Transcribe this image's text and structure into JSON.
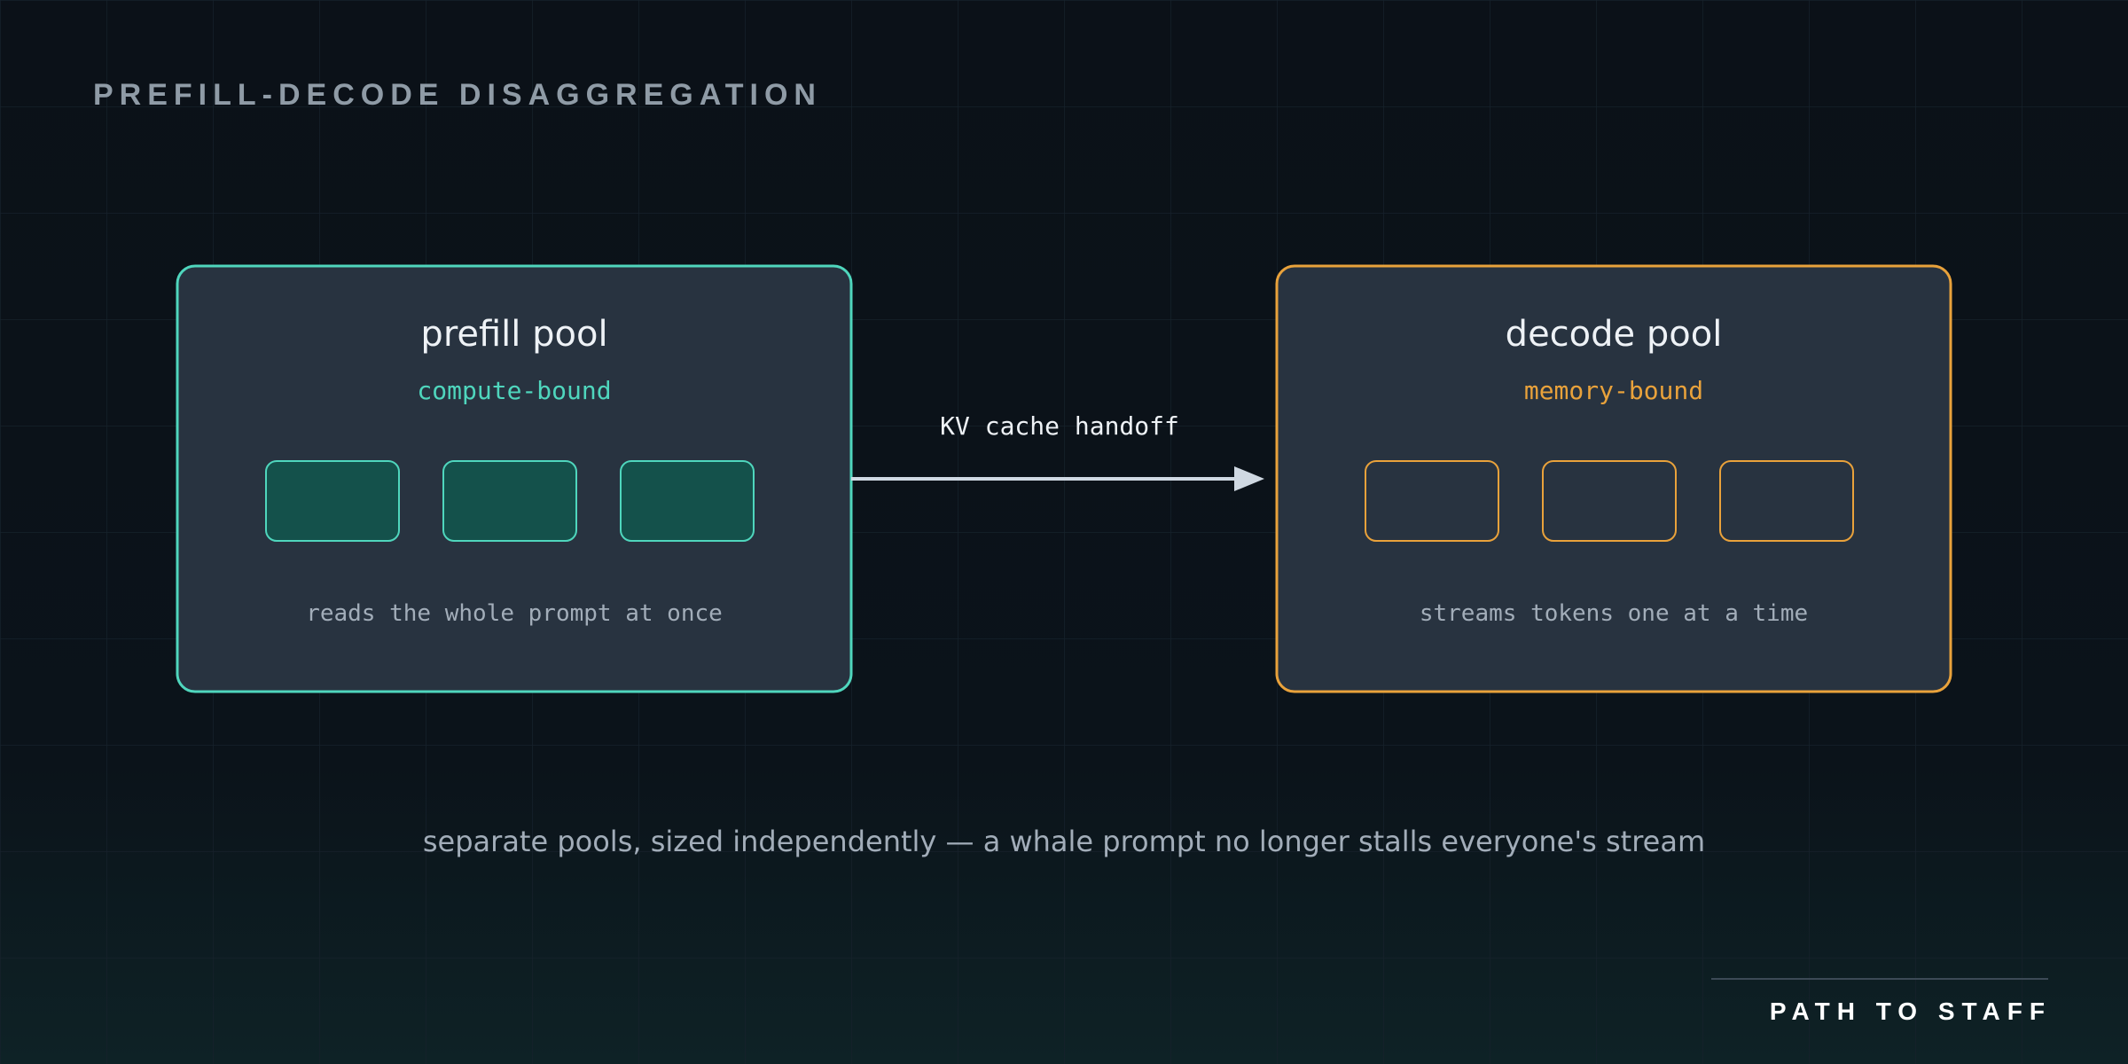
{
  "header": {
    "title": "PREFILL-DECODE DISAGGREGATION"
  },
  "pools": [
    {
      "name": "prefill pool",
      "subtitle": "compute-bound",
      "caption": "reads the whole prompt at once",
      "accent": "#4fd6bd",
      "unit_fill": "#14514b",
      "unit_count": 3
    },
    {
      "name": "decode pool",
      "subtitle": "memory-bound",
      "caption": "streams tokens one at a time",
      "accent": "#e9a23b",
      "unit_fill": "#283340",
      "unit_count": 3
    }
  ],
  "handoff": {
    "label": "KV cache handoff",
    "color": "#cfd8e2"
  },
  "footer": {
    "summary": "separate pools, sized independently — a whale prompt no longer stalls everyone's stream",
    "brand": "PATH TO STAFF"
  },
  "colors": {
    "background": "#0b1118",
    "panel": "#283340",
    "title": "#8f9ba6",
    "text": "#eef2f6",
    "muted": "#a2adb9",
    "brand": "#ffffff"
  }
}
